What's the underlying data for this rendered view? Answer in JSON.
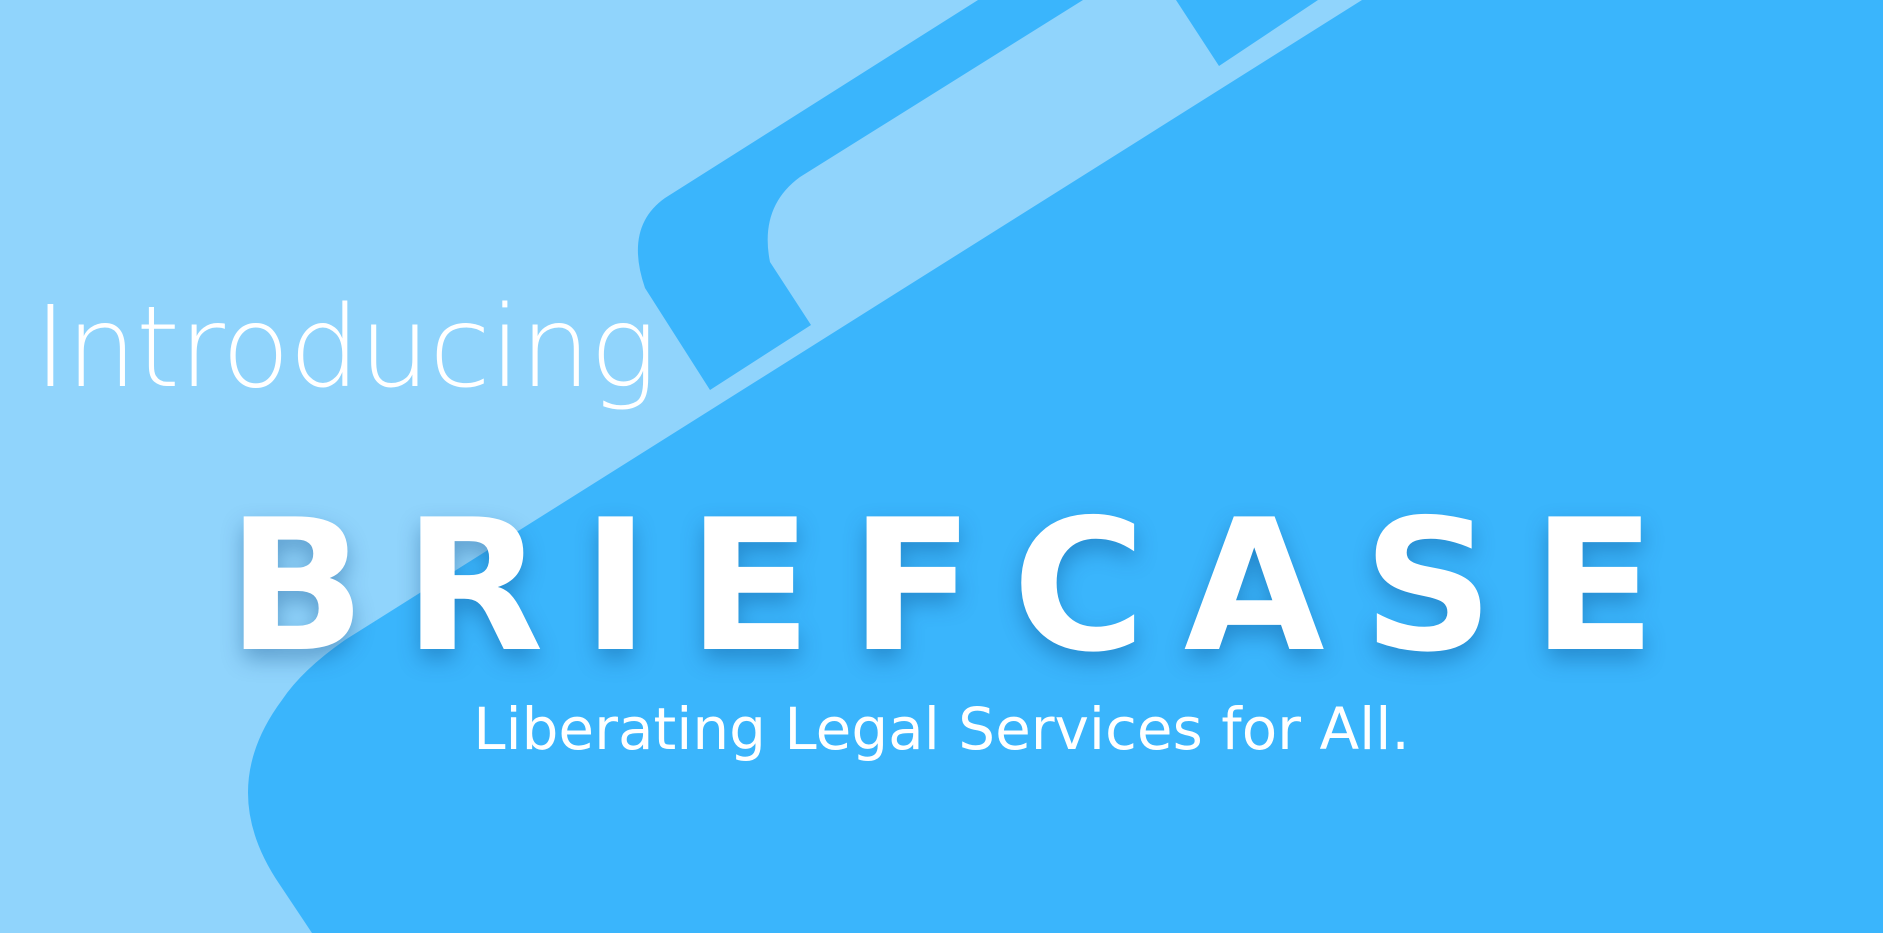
{
  "intro_text": "Introducing",
  "brand_name": "BRIEFCASE",
  "tagline": "Liberating Legal Services for All.",
  "colors": {
    "background_light": "#90d4fc",
    "briefcase_blue": "#3ab5fc",
    "text": "#ffffff"
  },
  "artwork": "briefcase-illustration"
}
